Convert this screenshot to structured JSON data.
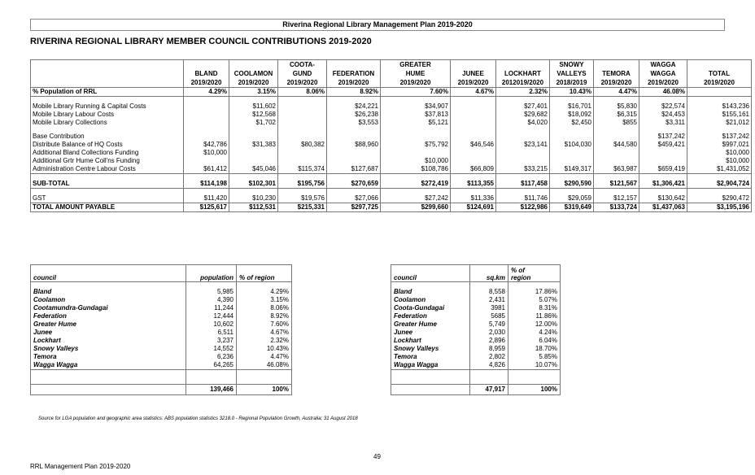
{
  "header": "Riverina Regional Library Management Plan 2019-2020",
  "title": "RIVERINA REGIONAL LIBRARY MEMBER COUNCIL CONTRIBUTIONS 2019-2020",
  "main": {
    "columns": [
      {
        "name": "BLAND",
        "year": "2019/2020"
      },
      {
        "name": "COOLAMON",
        "year": "2019/2020"
      },
      {
        "name": "COOTA-\nGUND",
        "year": "2019/2020"
      },
      {
        "name": "FEDERATION",
        "year": "2019/2020"
      },
      {
        "name": "GREATER\nHUME",
        "year": "2019/2020"
      },
      {
        "name": "JUNEE",
        "year": "2019/2020"
      },
      {
        "name": "LOCKHART",
        "year": "2012019/2020"
      },
      {
        "name": "SNOWY\nVALLEYS",
        "year": "2018/2019"
      },
      {
        "name": "TEMORA",
        "year": "2019/2020"
      },
      {
        "name": "WAGGA\nWAGGA",
        "year": "2019/2020"
      },
      {
        "name": "TOTAL",
        "year": "2019/2020"
      }
    ],
    "population_row": {
      "label": "% Population of RRL",
      "values": [
        "4.29%",
        "3.15%",
        "8.06%",
        "8.92%",
        "7.60%",
        "4.67%",
        "2.32%",
        "10.43%",
        "4.47%",
        "46.08%",
        ""
      ]
    },
    "group1": [
      {
        "label": "Mobile Library Running & Capital Costs",
        "values": [
          "",
          "$11,602",
          "",
          "$24,221",
          "$34,907",
          "",
          "$27,401",
          "$16,701",
          "$5,830",
          "$22,574",
          "$143,236"
        ]
      },
      {
        "label": "Mobile Library Labour Costs",
        "values": [
          "",
          "$12,568",
          "",
          "$26,238",
          "$37,813",
          "",
          "$29,682",
          "$18,092",
          "$6,315",
          "$24,453",
          "$155,161"
        ]
      },
      {
        "label": "Mobile Library Collections",
        "values": [
          "",
          "$1,702",
          "",
          "$3,553",
          "$5,121",
          "",
          "$4,020",
          "$2,450",
          "$855",
          "$3,311",
          "$21,012"
        ]
      }
    ],
    "group2": [
      {
        "label": "Base Contribution",
        "values": [
          "",
          "",
          "",
          "",
          "",
          "",
          "",
          "",
          "",
          "$137,242",
          "$137,242"
        ]
      },
      {
        "label": "Distribute Balance of HQ Costs",
        "values": [
          "$42,786",
          "$31,383",
          "$80,382",
          "$88,960",
          "$75,792",
          "$46,546",
          "$23,141",
          "$104,030",
          "$44,580",
          "$459,421",
          "$997,021"
        ]
      },
      {
        "label": "Additional Bland Collections Funding",
        "values": [
          "$10,000",
          "",
          "",
          "",
          "",
          "",
          "",
          "",
          "",
          "",
          "$10,000"
        ]
      },
      {
        "label": "Additional Grtr Hume Coll'ns Funding",
        "values": [
          "",
          "",
          "",
          "",
          "$10,000",
          "",
          "",
          "",
          "",
          "",
          "$10,000"
        ]
      },
      {
        "label": "Administration Centre Labour Costs",
        "values": [
          "$61,412",
          "$45,046",
          "$115,374",
          "$127,687",
          "$108,786",
          "$66,809",
          "$33,215",
          "$149,317",
          "$63,987",
          "$659,419",
          "$1,431,052"
        ]
      }
    ],
    "subtotal": {
      "label": "SUB-TOTAL",
      "values": [
        "$114,198",
        "$102,301",
        "$195,756",
        "$270,659",
        "$272,419",
        "$113,355",
        "$117,458",
        "$290,590",
        "$121,567",
        "$1,306,421",
        "$2,904,724"
      ]
    },
    "gst": {
      "label": "GST",
      "values": [
        "$11,420",
        "$10,230",
        "$19,576",
        "$27,066",
        "$27,242",
        "$11,336",
        "$11,746",
        "$29,059",
        "$12,157",
        "$130,642",
        "$290,472"
      ]
    },
    "total": {
      "label": "TOTAL AMOUNT PAYABLE",
      "values": [
        "$125,617",
        "$112,531",
        "$215,331",
        "$297,725",
        "$299,660",
        "$124,691",
        "$122,986",
        "$319,649",
        "$133,724",
        "$1,437,063",
        "$3,195,196"
      ]
    }
  },
  "pop_table": {
    "headers": [
      "council",
      "population",
      "% of region"
    ],
    "rows": [
      [
        "Bland",
        "5,985",
        "4.29%"
      ],
      [
        "Coolamon",
        "4,390",
        "3.15%"
      ],
      [
        "Cootamundra-Gundagai",
        "11,244",
        "8.06%"
      ],
      [
        "Federation",
        "12,444",
        "8.92%"
      ],
      [
        "Greater Hume",
        "10,602",
        "7.60%"
      ],
      [
        "Junee",
        "6,511",
        "4.67%"
      ],
      [
        "Lockhart",
        "3,237",
        "2.32%"
      ],
      [
        "Snowy Valleys",
        "14,552",
        "10.43%"
      ],
      [
        "Temora",
        "6,236",
        "4.47%"
      ],
      [
        "Wagga Wagga",
        "64,265",
        "46.08%"
      ]
    ],
    "total": [
      "",
      "139,466",
      "100%"
    ]
  },
  "area_table": {
    "headers": [
      "council",
      "sq.km",
      "% of\nregion"
    ],
    "rows": [
      [
        "Bland",
        "8,558",
        "17.86%"
      ],
      [
        "Coolamon",
        "2,431",
        "5.07%"
      ],
      [
        "Coota-Gundagai",
        "3981",
        "8.31%"
      ],
      [
        "Federation",
        "5685",
        "11.86%"
      ],
      [
        "Greater Hume",
        "5,749",
        "12.00%"
      ],
      [
        "Junee",
        "2,030",
        "4.24%"
      ],
      [
        "Lockhart",
        "2,896",
        "6.04%"
      ],
      [
        "Snowy Valleys",
        "8,959",
        "18.70%"
      ],
      [
        "Temora",
        "2,802",
        "5.85%"
      ],
      [
        "Wagga Wagga",
        "4,826",
        "10.07%"
      ]
    ],
    "total": [
      "",
      "47,917",
      "100%"
    ]
  },
  "source": "Source for LGA population and geographic area statistics: ABS population statistics 3218.0 - Regional Population Growth, Australia;  31 August 2018",
  "page_number": "49",
  "footer": "RRL Management Plan 2019-2020"
}
